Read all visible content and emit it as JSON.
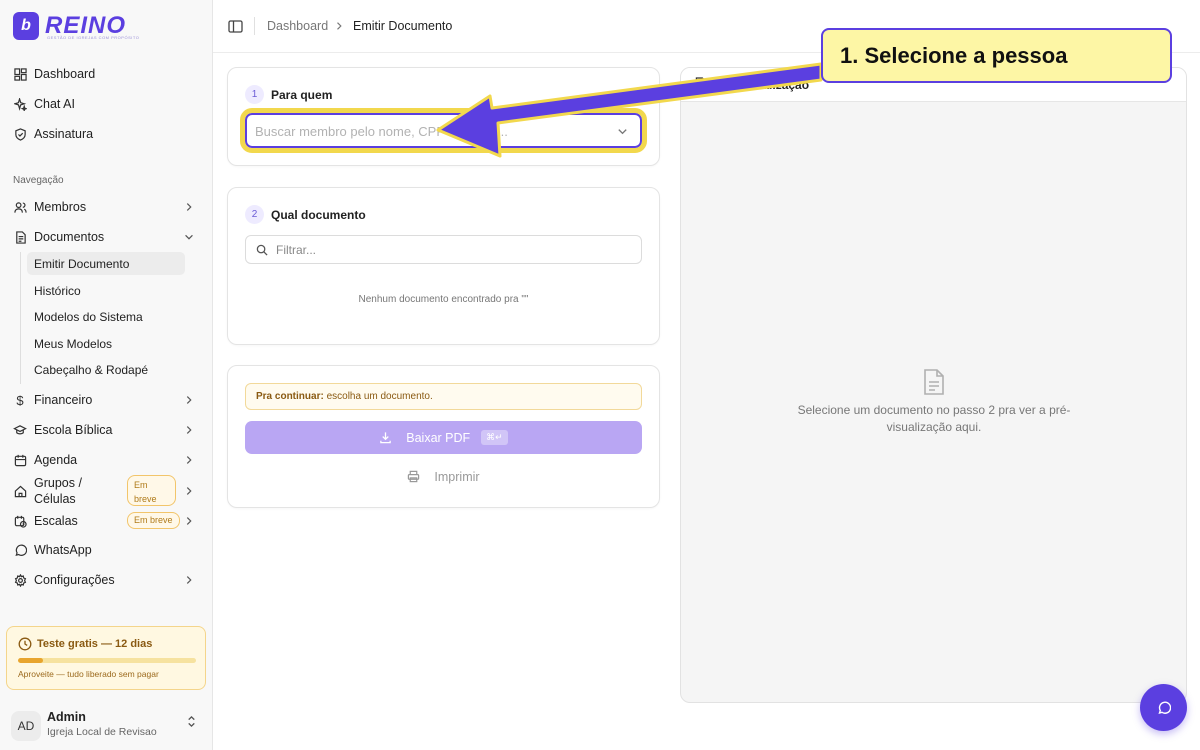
{
  "brand": {
    "name": "REINO",
    "tagline": "GESTÃO DE IGREJAS COM PROPÓSITO"
  },
  "sidebar": {
    "top_items": [
      {
        "label": "Dashboard",
        "icon": "grid-icon"
      },
      {
        "label": "Chat AI",
        "icon": "sparkles-icon"
      },
      {
        "label": "Assinatura",
        "icon": "shield-check-icon"
      }
    ],
    "section_label": "Navegação",
    "nav": {
      "membros": "Membros",
      "documentos": "Documentos",
      "documentos_sub": [
        "Emitir Documento",
        "Histórico",
        "Modelos do Sistema",
        "Meus Modelos",
        "Cabeçalho & Rodapé"
      ],
      "financeiro": "Financeiro",
      "escola": "Escola Bíblica",
      "agenda": "Agenda",
      "grupos": "Grupos / Células",
      "escalas": "Escalas",
      "whatsapp": "WhatsApp",
      "config": "Configurações"
    },
    "soon_label": "Em breve",
    "trial": {
      "title": "Teste gratis — 12 dias",
      "note": "Aproveite — tudo liberado sem pagar",
      "progress_fraction": 0.14
    },
    "user": {
      "initials": "AD",
      "name": "Admin",
      "org": "Igreja Local de Revisao"
    }
  },
  "topbar": {
    "breadcrumb": [
      "Dashboard",
      "Emitir Documento"
    ]
  },
  "step1": {
    "number": "1",
    "title": "Para quem",
    "placeholder": "Buscar membro pelo nome, CPF ou email..."
  },
  "step2": {
    "number": "2",
    "title": "Qual documento",
    "filter_placeholder": "Filtrar...",
    "empty": "Nenhum documento encontrado pra \"\""
  },
  "actions": {
    "notice_bold": "Pra continuar:",
    "notice_text": " escolha um documento.",
    "pdf_label": "Baixar PDF",
    "pdf_shortcut": "⌘↵",
    "print_label": "Imprimir"
  },
  "preview": {
    "title": "Pré-visualização",
    "empty": "Selecione um documento no passo 2 pra ver a pré-visualização aqui."
  },
  "annotation": {
    "text": "1. Selecione a pessoa",
    "accent": "#5b3fe0",
    "highlight": "#f2d84d"
  }
}
